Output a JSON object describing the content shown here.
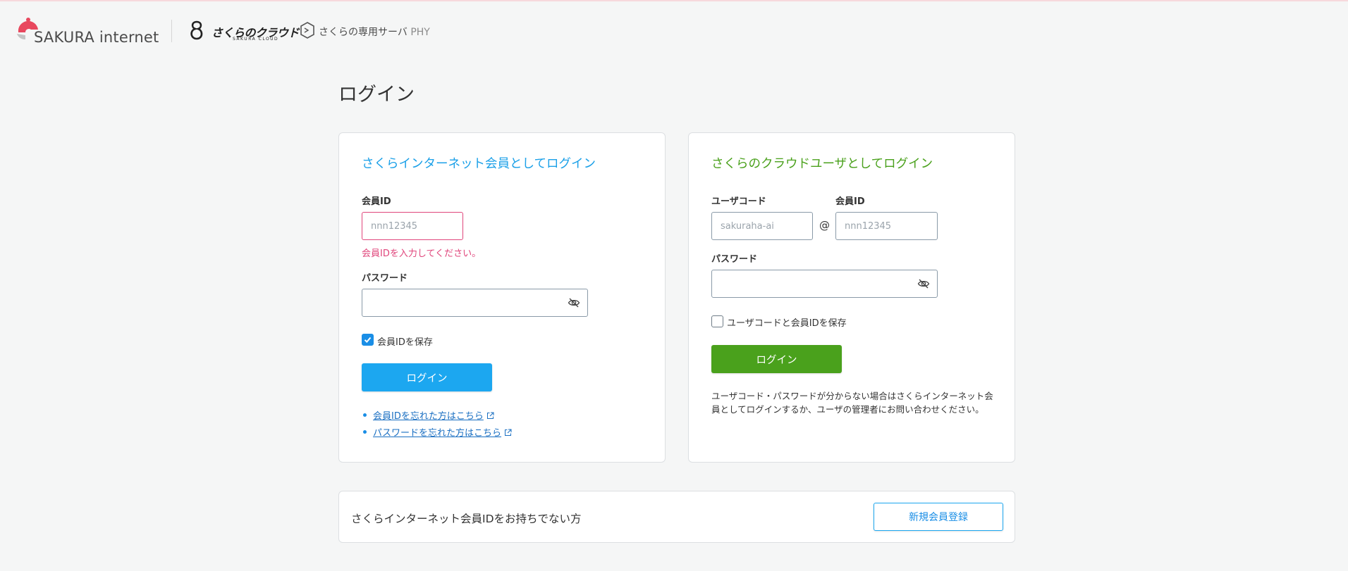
{
  "header": {
    "sakura_logo_text": "SAKURA internet",
    "cloud_logo_text": "さくらのクラウド",
    "cloud_logo_sub": "SAKURA CLOUD",
    "phy_logo_text": "さくらの専用サーバ",
    "phy_logo_suffix": "PHY"
  },
  "page": {
    "title": "ログイン"
  },
  "internet_login": {
    "title": "さくらインターネット会員としてログイン",
    "member_id_label": "会員ID",
    "member_id_placeholder": "nnn12345",
    "member_id_value": "",
    "member_id_error": "会員IDを入力してください。",
    "password_label": "パスワード",
    "password_value": "",
    "save_id_label": "会員IDを保存",
    "save_id_checked": true,
    "login_button": "ログイン",
    "links": [
      {
        "label": "会員IDを忘れた方はこちら"
      },
      {
        "label": "パスワードを忘れた方はこちら"
      }
    ]
  },
  "cloud_login": {
    "title": "さくらのクラウドユーザとしてログイン",
    "user_code_label": "ユーザコード",
    "user_code_placeholder": "sakuraha-ai",
    "at_sign": "@",
    "member_id_label": "会員ID",
    "member_id_placeholder": "nnn12345",
    "password_label": "パスワード",
    "save_label": "ユーザコードと会員IDを保存",
    "save_checked": false,
    "login_button": "ログイン",
    "note": "ユーザコード・パスワードが分からない場合はさくらインターネット会員としてログインするか、ユーザの管理者にお問い合わせください。"
  },
  "register": {
    "text": "さくらインターネット会員IDをお持ちでない方",
    "button": "新規会員登録"
  },
  "colors": {
    "internet_accent": "#1ba0e8",
    "cloud_accent": "#4aa11c",
    "error": "#e0457b",
    "link": "#1a6fc2"
  },
  "icons": {
    "password_toggle": "eye-off-icon",
    "external_link": "external-link-icon",
    "checkbox_checked": "check-icon"
  }
}
